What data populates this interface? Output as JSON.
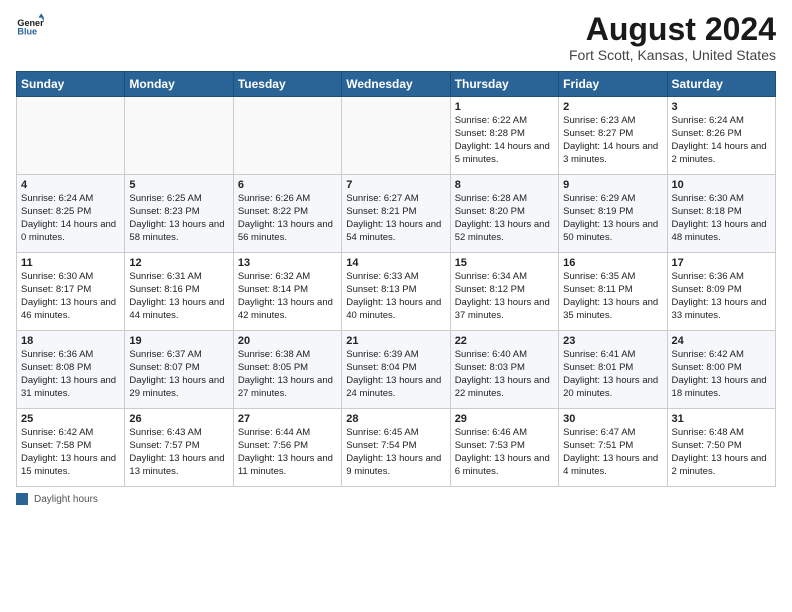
{
  "logo": {
    "line1": "General",
    "line2": "Blue"
  },
  "title": "August 2024",
  "subtitle": "Fort Scott, Kansas, United States",
  "days_of_week": [
    "Sunday",
    "Monday",
    "Tuesday",
    "Wednesday",
    "Thursday",
    "Friday",
    "Saturday"
  ],
  "weeks": [
    [
      {
        "num": "",
        "data": ""
      },
      {
        "num": "",
        "data": ""
      },
      {
        "num": "",
        "data": ""
      },
      {
        "num": "",
        "data": ""
      },
      {
        "num": "1",
        "data": "Sunrise: 6:22 AM\nSunset: 8:28 PM\nDaylight: 14 hours and 5 minutes."
      },
      {
        "num": "2",
        "data": "Sunrise: 6:23 AM\nSunset: 8:27 PM\nDaylight: 14 hours and 3 minutes."
      },
      {
        "num": "3",
        "data": "Sunrise: 6:24 AM\nSunset: 8:26 PM\nDaylight: 14 hours and 2 minutes."
      }
    ],
    [
      {
        "num": "4",
        "data": "Sunrise: 6:24 AM\nSunset: 8:25 PM\nDaylight: 14 hours and 0 minutes."
      },
      {
        "num": "5",
        "data": "Sunrise: 6:25 AM\nSunset: 8:23 PM\nDaylight: 13 hours and 58 minutes."
      },
      {
        "num": "6",
        "data": "Sunrise: 6:26 AM\nSunset: 8:22 PM\nDaylight: 13 hours and 56 minutes."
      },
      {
        "num": "7",
        "data": "Sunrise: 6:27 AM\nSunset: 8:21 PM\nDaylight: 13 hours and 54 minutes."
      },
      {
        "num": "8",
        "data": "Sunrise: 6:28 AM\nSunset: 8:20 PM\nDaylight: 13 hours and 52 minutes."
      },
      {
        "num": "9",
        "data": "Sunrise: 6:29 AM\nSunset: 8:19 PM\nDaylight: 13 hours and 50 minutes."
      },
      {
        "num": "10",
        "data": "Sunrise: 6:30 AM\nSunset: 8:18 PM\nDaylight: 13 hours and 48 minutes."
      }
    ],
    [
      {
        "num": "11",
        "data": "Sunrise: 6:30 AM\nSunset: 8:17 PM\nDaylight: 13 hours and 46 minutes."
      },
      {
        "num": "12",
        "data": "Sunrise: 6:31 AM\nSunset: 8:16 PM\nDaylight: 13 hours and 44 minutes."
      },
      {
        "num": "13",
        "data": "Sunrise: 6:32 AM\nSunset: 8:14 PM\nDaylight: 13 hours and 42 minutes."
      },
      {
        "num": "14",
        "data": "Sunrise: 6:33 AM\nSunset: 8:13 PM\nDaylight: 13 hours and 40 minutes."
      },
      {
        "num": "15",
        "data": "Sunrise: 6:34 AM\nSunset: 8:12 PM\nDaylight: 13 hours and 37 minutes."
      },
      {
        "num": "16",
        "data": "Sunrise: 6:35 AM\nSunset: 8:11 PM\nDaylight: 13 hours and 35 minutes."
      },
      {
        "num": "17",
        "data": "Sunrise: 6:36 AM\nSunset: 8:09 PM\nDaylight: 13 hours and 33 minutes."
      }
    ],
    [
      {
        "num": "18",
        "data": "Sunrise: 6:36 AM\nSunset: 8:08 PM\nDaylight: 13 hours and 31 minutes."
      },
      {
        "num": "19",
        "data": "Sunrise: 6:37 AM\nSunset: 8:07 PM\nDaylight: 13 hours and 29 minutes."
      },
      {
        "num": "20",
        "data": "Sunrise: 6:38 AM\nSunset: 8:05 PM\nDaylight: 13 hours and 27 minutes."
      },
      {
        "num": "21",
        "data": "Sunrise: 6:39 AM\nSunset: 8:04 PM\nDaylight: 13 hours and 24 minutes."
      },
      {
        "num": "22",
        "data": "Sunrise: 6:40 AM\nSunset: 8:03 PM\nDaylight: 13 hours and 22 minutes."
      },
      {
        "num": "23",
        "data": "Sunrise: 6:41 AM\nSunset: 8:01 PM\nDaylight: 13 hours and 20 minutes."
      },
      {
        "num": "24",
        "data": "Sunrise: 6:42 AM\nSunset: 8:00 PM\nDaylight: 13 hours and 18 minutes."
      }
    ],
    [
      {
        "num": "25",
        "data": "Sunrise: 6:42 AM\nSunset: 7:58 PM\nDaylight: 13 hours and 15 minutes."
      },
      {
        "num": "26",
        "data": "Sunrise: 6:43 AM\nSunset: 7:57 PM\nDaylight: 13 hours and 13 minutes."
      },
      {
        "num": "27",
        "data": "Sunrise: 6:44 AM\nSunset: 7:56 PM\nDaylight: 13 hours and 11 minutes."
      },
      {
        "num": "28",
        "data": "Sunrise: 6:45 AM\nSunset: 7:54 PM\nDaylight: 13 hours and 9 minutes."
      },
      {
        "num": "29",
        "data": "Sunrise: 6:46 AM\nSunset: 7:53 PM\nDaylight: 13 hours and 6 minutes."
      },
      {
        "num": "30",
        "data": "Sunrise: 6:47 AM\nSunset: 7:51 PM\nDaylight: 13 hours and 4 minutes."
      },
      {
        "num": "31",
        "data": "Sunrise: 6:48 AM\nSunset: 7:50 PM\nDaylight: 13 hours and 2 minutes."
      }
    ]
  ],
  "legend": {
    "label": "Daylight hours"
  }
}
